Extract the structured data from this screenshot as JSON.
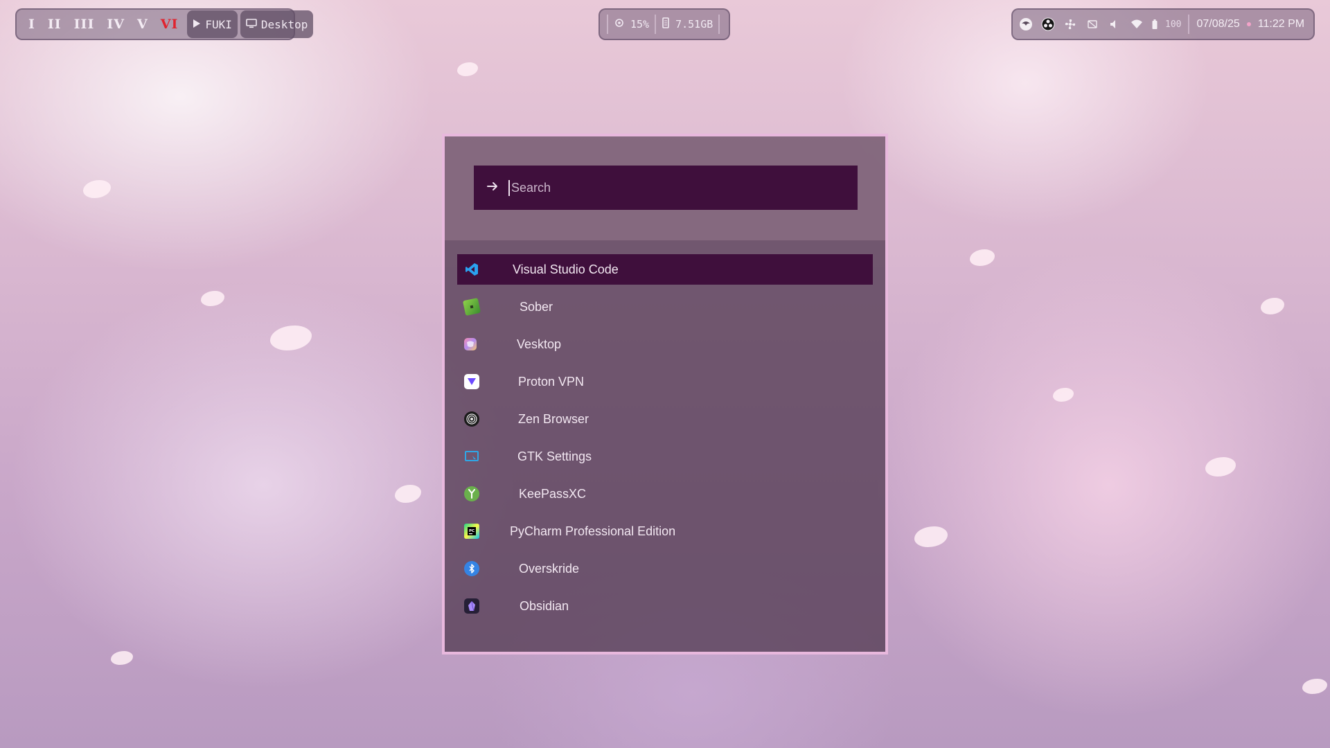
{
  "topbar": {
    "workspaces": [
      {
        "label": "I",
        "active": false
      },
      {
        "label": "II",
        "active": false
      },
      {
        "label": "III",
        "active": false
      },
      {
        "label": "IV",
        "active": false
      },
      {
        "label": "V",
        "active": false
      },
      {
        "label": "VI",
        "active": true
      }
    ],
    "media_label": "FUKI",
    "desktop_label": "Desktop",
    "cpu": "15%",
    "memory": "7.51GB",
    "battery": "100",
    "date": "07/08/25",
    "time": "11:22 PM",
    "icons": {
      "media": "play-icon",
      "desktop": "monitor-icon",
      "cpu": "cpu-icon",
      "memory": "memory-icon",
      "tray": [
        "browser-icon",
        "obs-icon",
        "fan-icon",
        "caffeine-icon",
        "volume-icon",
        "wifi-icon",
        "battery-icon"
      ]
    }
  },
  "launcher": {
    "search": {
      "placeholder": "Search",
      "value": "",
      "icon": "arrow-right-icon"
    },
    "apps": [
      {
        "label": "Visual Studio Code",
        "icon": "vscode-icon",
        "selected": true
      },
      {
        "label": "Sober",
        "icon": "sober-icon",
        "selected": false
      },
      {
        "label": "Vesktop",
        "icon": "vesktop-icon",
        "selected": false
      },
      {
        "label": "Proton VPN",
        "icon": "protonvpn-icon",
        "selected": false
      },
      {
        "label": "Zen Browser",
        "icon": "zen-browser-icon",
        "selected": false
      },
      {
        "label": "GTK Settings",
        "icon": "gtk-settings-icon",
        "selected": false
      },
      {
        "label": "KeePassXC",
        "icon": "keepassxc-icon",
        "selected": false
      },
      {
        "label": "PyCharm Professional Edition",
        "icon": "pycharm-icon",
        "selected": false
      },
      {
        "label": "Overskride",
        "icon": "bluetooth-icon",
        "selected": false
      },
      {
        "label": "Obsidian",
        "icon": "obsidian-icon",
        "selected": false
      }
    ]
  },
  "colors": {
    "accent": "#3f0f3c",
    "border": "#e8b8dd",
    "active_workspace": "#e0242f"
  }
}
